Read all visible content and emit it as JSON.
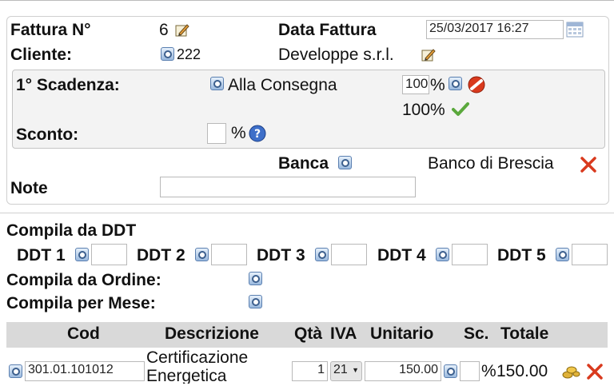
{
  "invoice": {
    "number_label": "Fattura N°",
    "number_value": "6",
    "date_label": "Data Fattura",
    "date_value": "25/03/2017 16:27",
    "client_label": "Cliente:",
    "client_code": "222",
    "client_name": "Developpe s.r.l."
  },
  "payment": {
    "deadline_label": "1° Scadenza:",
    "deadline_value": "Alla Consegna",
    "percent_value": "100",
    "percent_sign": "%",
    "total_percent": "100%",
    "discount_label": "Sconto:",
    "discount_value": "",
    "discount_unit": "%",
    "bank_label": "Banca",
    "bank_value": "Banco di Brescia",
    "notes_label": "Note",
    "notes_value": ""
  },
  "compile": {
    "ddt_title": "Compila da DDT",
    "ddt_items": [
      "DDT 1",
      "DDT 2",
      "DDT 3",
      "DDT 4",
      "DDT 5"
    ],
    "order_label": "Compila da Ordine:",
    "month_label": "Compila per Mese:"
  },
  "table": {
    "headers": [
      "Cod",
      "Descrizione",
      "Qtà",
      "IVA",
      "Unitario",
      "Sc.",
      "Totale"
    ],
    "rows": [
      {
        "code": "301.01.101012",
        "description": "Certificazione Energetica",
        "qty": "1",
        "vat": "21",
        "unit_price": "150.00",
        "discount": "",
        "discount_unit": "%",
        "total": "150.00"
      }
    ]
  },
  "icons": [
    "edit-icon",
    "calendar-icon",
    "search-icon",
    "delete-icon",
    "check-icon",
    "help-icon",
    "close-icon",
    "coins-icon"
  ],
  "colors": {
    "header_bg": "#d9d9d9",
    "delete_red": "#d93a1e",
    "check_green": "#5aa83c",
    "help_blue": "#3e6fc9"
  }
}
